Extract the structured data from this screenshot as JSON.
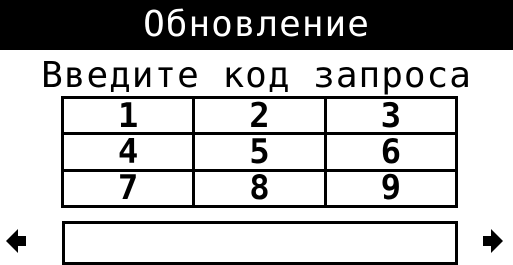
{
  "header": {
    "title": "Обновление"
  },
  "prompt": {
    "text": "Введите код запроса"
  },
  "keypad": {
    "rows": [
      [
        "1",
        "2",
        "3"
      ],
      [
        "4",
        "5",
        "6"
      ],
      [
        "7",
        "8",
        "9"
      ]
    ]
  },
  "navigation": {
    "left_icon": "arrow-left-icon",
    "right_icon": "arrow-right-icon"
  },
  "code_field": {
    "value": ""
  },
  "colors": {
    "background": "#ffffff",
    "foreground": "#000000"
  }
}
